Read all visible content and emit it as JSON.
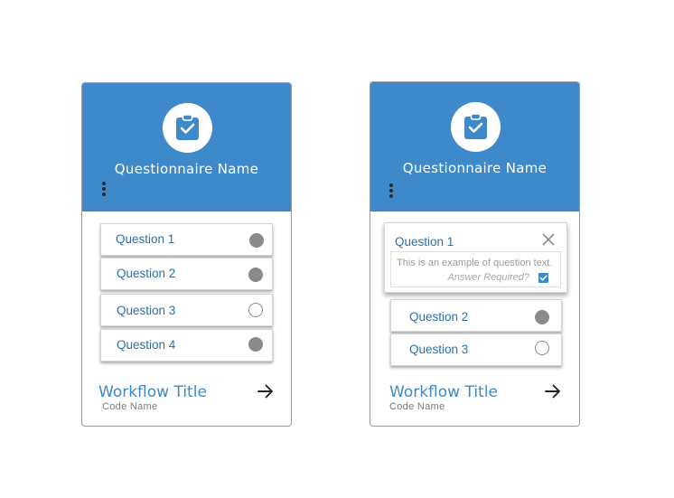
{
  "cards": [
    {
      "questionnaire_name": "Questionnaire Name",
      "questions": [
        {
          "label": "Question 1",
          "status": "complete"
        },
        {
          "label": "Question 2",
          "status": "complete"
        },
        {
          "label": "Question 3",
          "status": "incomplete"
        },
        {
          "label": "Question 4",
          "status": "complete"
        }
      ],
      "workflow_title": "Workflow Title",
      "code_name": "Code Name"
    },
    {
      "questionnaire_name": "Questionnaire Name",
      "expanded_question": {
        "label": "Question 1",
        "answer_text": "This is an example of question text.",
        "answer_required_label": "Answer Required?",
        "answer_required_checked": true
      },
      "questions": [
        {
          "label": "Question 2",
          "status": "complete"
        },
        {
          "label": "Question 3",
          "status": "incomplete"
        }
      ],
      "workflow_title": "Workflow Title",
      "code_name": "Code Name"
    }
  ],
  "icons": {
    "header_icon": "clipboard-check-icon",
    "menu_icon": "more-vertical-icon",
    "workflow_icon": "arrow-right-icon",
    "close_icon": "close-icon",
    "checkbox_icon": "checkbox-checked-icon"
  },
  "colors": {
    "accent": "#3d89c9",
    "status_filled": "#8a8a8a",
    "question_text": "#2f6fa5"
  }
}
